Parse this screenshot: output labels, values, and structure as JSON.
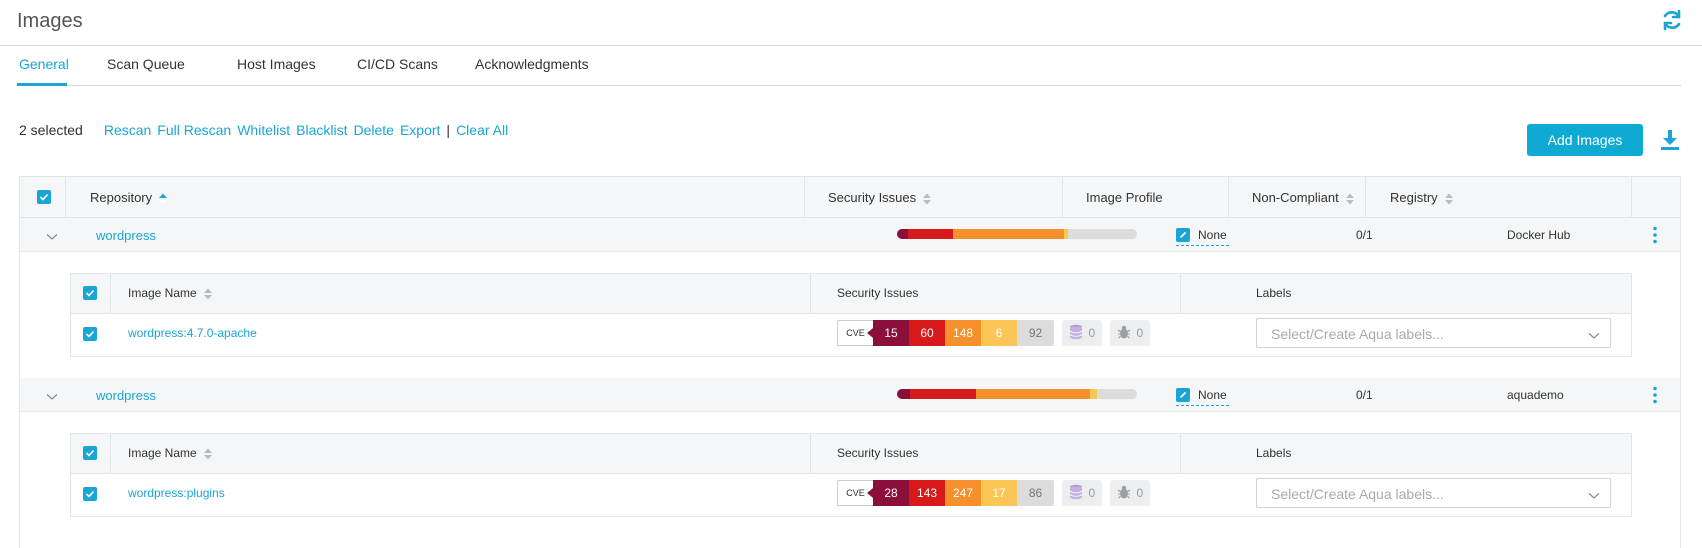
{
  "page": {
    "title": "Images"
  },
  "tabs": [
    {
      "label": "General",
      "active": true
    },
    {
      "label": "Scan Queue",
      "active": false
    },
    {
      "label": "Host Images",
      "active": false
    },
    {
      "label": "CI/CD Scans",
      "active": false
    },
    {
      "label": "Acknowledgments",
      "active": false
    }
  ],
  "toolbar": {
    "selected_count": "2 selected",
    "actions": [
      "Rescan",
      "Full Rescan",
      "Whitelist",
      "Blacklist",
      "Delete",
      "Export"
    ],
    "separator": "|",
    "clear_all": "Clear All",
    "add_images": "Add Images"
  },
  "table": {
    "headers": {
      "repository": "Repository",
      "security_issues": "Security Issues",
      "image_profile": "Image Profile",
      "non_compliant": "Non-Compliant",
      "registry": "Registry"
    },
    "subheaders": {
      "image_name": "Image Name",
      "security_issues": "Security Issues",
      "labels": "Labels"
    },
    "repos": [
      {
        "name": "wordpress",
        "profile": "None",
        "non_compliant": "0/1",
        "registry": "Docker Hub",
        "issue_bar": {
          "critical": 15,
          "high": 60,
          "medium": 148,
          "low": 6,
          "negligible": 92
        },
        "image": {
          "name": "wordpress:4.7.0-apache",
          "cve_label": "CVE",
          "critical": "15",
          "high": "60",
          "medium": "148",
          "low": "6",
          "negligible": "92",
          "malware": "0",
          "sensitive": "0",
          "labels_placeholder": "Select/Create Aqua labels..."
        }
      },
      {
        "name": "wordpress",
        "profile": "None",
        "non_compliant": "0/1",
        "registry": "aquademo",
        "issue_bar": {
          "critical": 28,
          "high": 143,
          "medium": 247,
          "low": 17,
          "negligible": 86
        },
        "image": {
          "name": "wordpress:plugins",
          "cve_label": "CVE",
          "critical": "28",
          "high": "143",
          "medium": "247",
          "low": "17",
          "negligible": "86",
          "malware": "0",
          "sensitive": "0",
          "labels_placeholder": "Select/Create Aqua labels..."
        }
      }
    ]
  },
  "colors": {
    "accent": "#1aa5d6",
    "critical": "#8a0f3a",
    "high": "#d7191c",
    "medium": "#f5902b",
    "low": "#fbc657",
    "negligible": "#dcdcdc"
  },
  "icons": {
    "refresh": "refresh-icon",
    "download": "download-icon",
    "sort": "sort-icon",
    "chevron": "chevron-down-icon",
    "kebab": "kebab-menu-icon",
    "edit": "edit-icon",
    "database": "database-icon",
    "bug": "bug-icon"
  }
}
